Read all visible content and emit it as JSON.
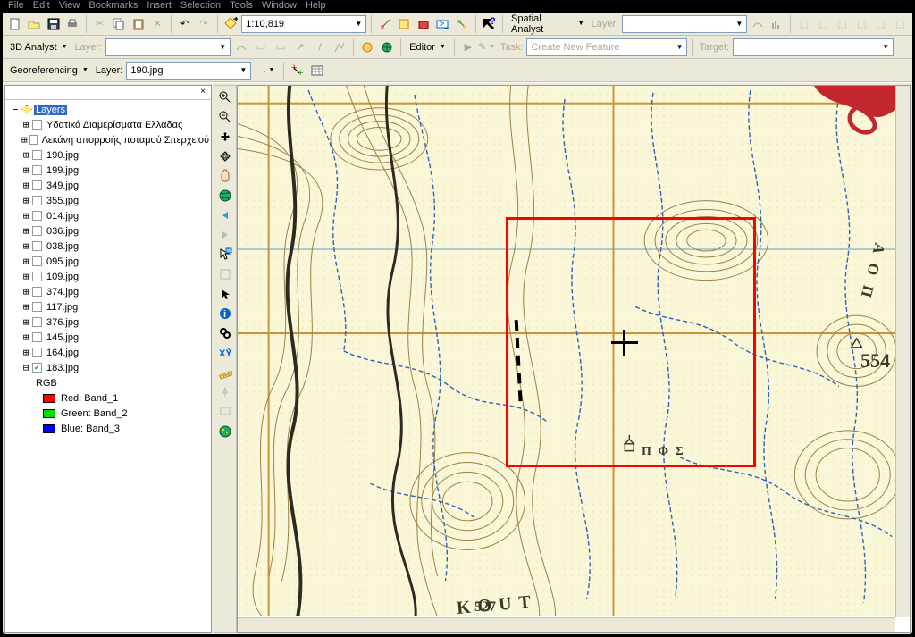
{
  "menu": {
    "items": [
      "File",
      "Edit",
      "View",
      "Bookmarks",
      "Insert",
      "Selection",
      "Tools",
      "Window",
      "Help"
    ]
  },
  "scale": "1:10,819",
  "spatial_analyst": {
    "label": "Spatial Analyst",
    "layer_label": "Layer:",
    "layer_val": ""
  },
  "threeD": {
    "label": "3D Analyst",
    "layer_label": "Layer:",
    "layer_val": ""
  },
  "editor": {
    "label": "Editor",
    "task_label": "Task:",
    "task_val": "Create New Feature",
    "target_label": "Target:",
    "target_val": ""
  },
  "georef": {
    "label": "Georeferencing",
    "layer_label": "Layer:",
    "layer_val": "190.jpg"
  },
  "toc": {
    "root": "Layers",
    "items": [
      {
        "label": "Υδατικά Διαμερίσματα Ελλάδας",
        "checked": false,
        "twist": "+"
      },
      {
        "label": "Λεκάνη απορροής ποταμού Σπερχειού",
        "checked": false,
        "twist": "+"
      },
      {
        "label": "190.jpg",
        "checked": false,
        "twist": "+"
      },
      {
        "label": "199.jpg",
        "checked": false,
        "twist": "+"
      },
      {
        "label": "349.jpg",
        "checked": false,
        "twist": "+"
      },
      {
        "label": "355.jpg",
        "checked": false,
        "twist": "+"
      },
      {
        "label": "014.jpg",
        "checked": false,
        "twist": "+"
      },
      {
        "label": "036.jpg",
        "checked": false,
        "twist": "+"
      },
      {
        "label": "038.jpg",
        "checked": false,
        "twist": "+"
      },
      {
        "label": "095.jpg",
        "checked": false,
        "twist": "+"
      },
      {
        "label": "109.jpg",
        "checked": false,
        "twist": "+"
      },
      {
        "label": "374.jpg",
        "checked": false,
        "twist": "+"
      },
      {
        "label": "117.jpg",
        "checked": false,
        "twist": "+"
      },
      {
        "label": "376.jpg",
        "checked": false,
        "twist": "+"
      },
      {
        "label": "145.jpg",
        "checked": false,
        "twist": "+"
      },
      {
        "label": "164.jpg",
        "checked": false,
        "twist": "+"
      },
      {
        "label": "183.jpg",
        "checked": true,
        "twist": "−"
      }
    ],
    "rgb_label": "RGB",
    "bands": [
      {
        "color": "R",
        "label": "Red:   Band_1"
      },
      {
        "color": "G",
        "label": "Green: Band_2"
      },
      {
        "color": "B",
        "label": "Blue:  Band_3"
      }
    ]
  },
  "map": {
    "spot_height": "554",
    "elevation_527": "527",
    "text_kouti": "KOUT",
    "text_aop": "A O Π",
    "pos_label": "Π Φ Σ"
  }
}
